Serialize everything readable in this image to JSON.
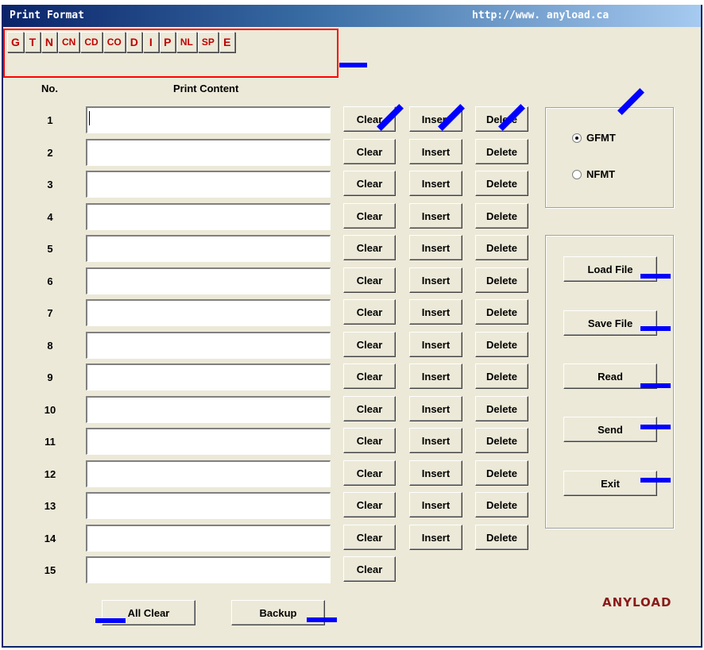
{
  "window": {
    "title": "Print Format",
    "url": "http://www. anyload.ca"
  },
  "tokens": [
    "G",
    "T",
    "N",
    "CN",
    "CD",
    "CO",
    "D",
    "I",
    "P",
    "NL",
    "SP",
    "E"
  ],
  "table": {
    "col_no": "No.",
    "col_content": "Print Content"
  },
  "rows": [
    {
      "no": "1",
      "content": ""
    },
    {
      "no": "2",
      "content": ""
    },
    {
      "no": "3",
      "content": ""
    },
    {
      "no": "4",
      "content": ""
    },
    {
      "no": "5",
      "content": ""
    },
    {
      "no": "6",
      "content": ""
    },
    {
      "no": "7",
      "content": ""
    },
    {
      "no": "8",
      "content": ""
    },
    {
      "no": "9",
      "content": ""
    },
    {
      "no": "10",
      "content": ""
    },
    {
      "no": "11",
      "content": ""
    },
    {
      "no": "12",
      "content": ""
    },
    {
      "no": "13",
      "content": ""
    },
    {
      "no": "14",
      "content": ""
    },
    {
      "no": "15",
      "content": ""
    }
  ],
  "row_buttons": {
    "clear": "Clear",
    "insert": "Insert",
    "delete": "Delete"
  },
  "format_options": {
    "gfmt": "GFMT",
    "nfmt": "NFMT",
    "selected": "GFMT"
  },
  "file_buttons": {
    "load": "Load File",
    "save": "Save File",
    "read": "Read",
    "send": "Send",
    "exit": "Exit"
  },
  "bottom_buttons": {
    "all_clear": "All Clear",
    "backup": "Backup"
  },
  "brand": "ANYLOAD",
  "colors": {
    "token_text": "#c00000",
    "highlight_box": "#ff0000",
    "annotation": "#0000ff",
    "title_bar": "#0a246a"
  }
}
